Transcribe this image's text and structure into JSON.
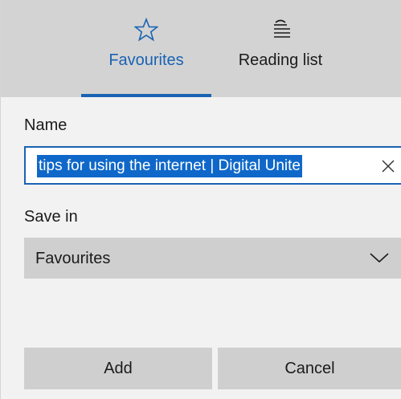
{
  "tabs": {
    "favourites": {
      "label": "Favourites",
      "icon": "star-icon",
      "active": true
    },
    "reading_list": {
      "label": "Reading list",
      "icon": "reading-list-icon",
      "active": false
    }
  },
  "form": {
    "name_label": "Name",
    "name_value": "tips for using the internet | Digital Unite",
    "save_in_label": "Save in",
    "save_in_value": "Favourites"
  },
  "buttons": {
    "add": "Add",
    "cancel": "Cancel"
  },
  "colors": {
    "accent": "#1a63b3",
    "selection": "#0f68c9",
    "header_bg": "#d3d3d3",
    "panel_bg": "#f2f2f2",
    "control_bg": "#cfcfcf"
  }
}
